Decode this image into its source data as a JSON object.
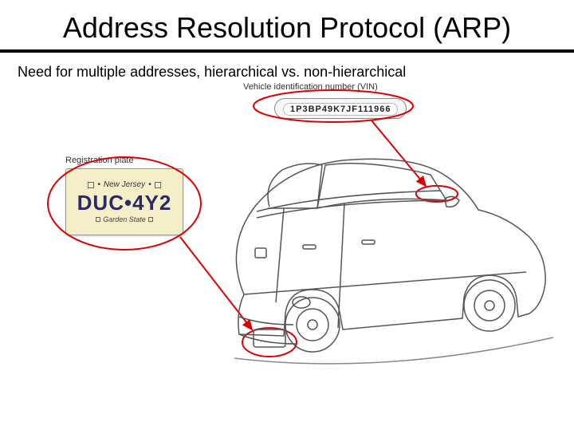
{
  "slide": {
    "title": "Address Resolution Protocol (ARP)",
    "subtitle": "Need for multiple addresses, hierarchical vs. non-hierarchical"
  },
  "vin": {
    "label": "Vehicle identification number (VIN)",
    "value": "1P3BP49K7JF111966"
  },
  "plate": {
    "label": "Registration plate",
    "state": "New Jersey",
    "code": "DUC•4Y2",
    "tagline": "Garden State"
  }
}
